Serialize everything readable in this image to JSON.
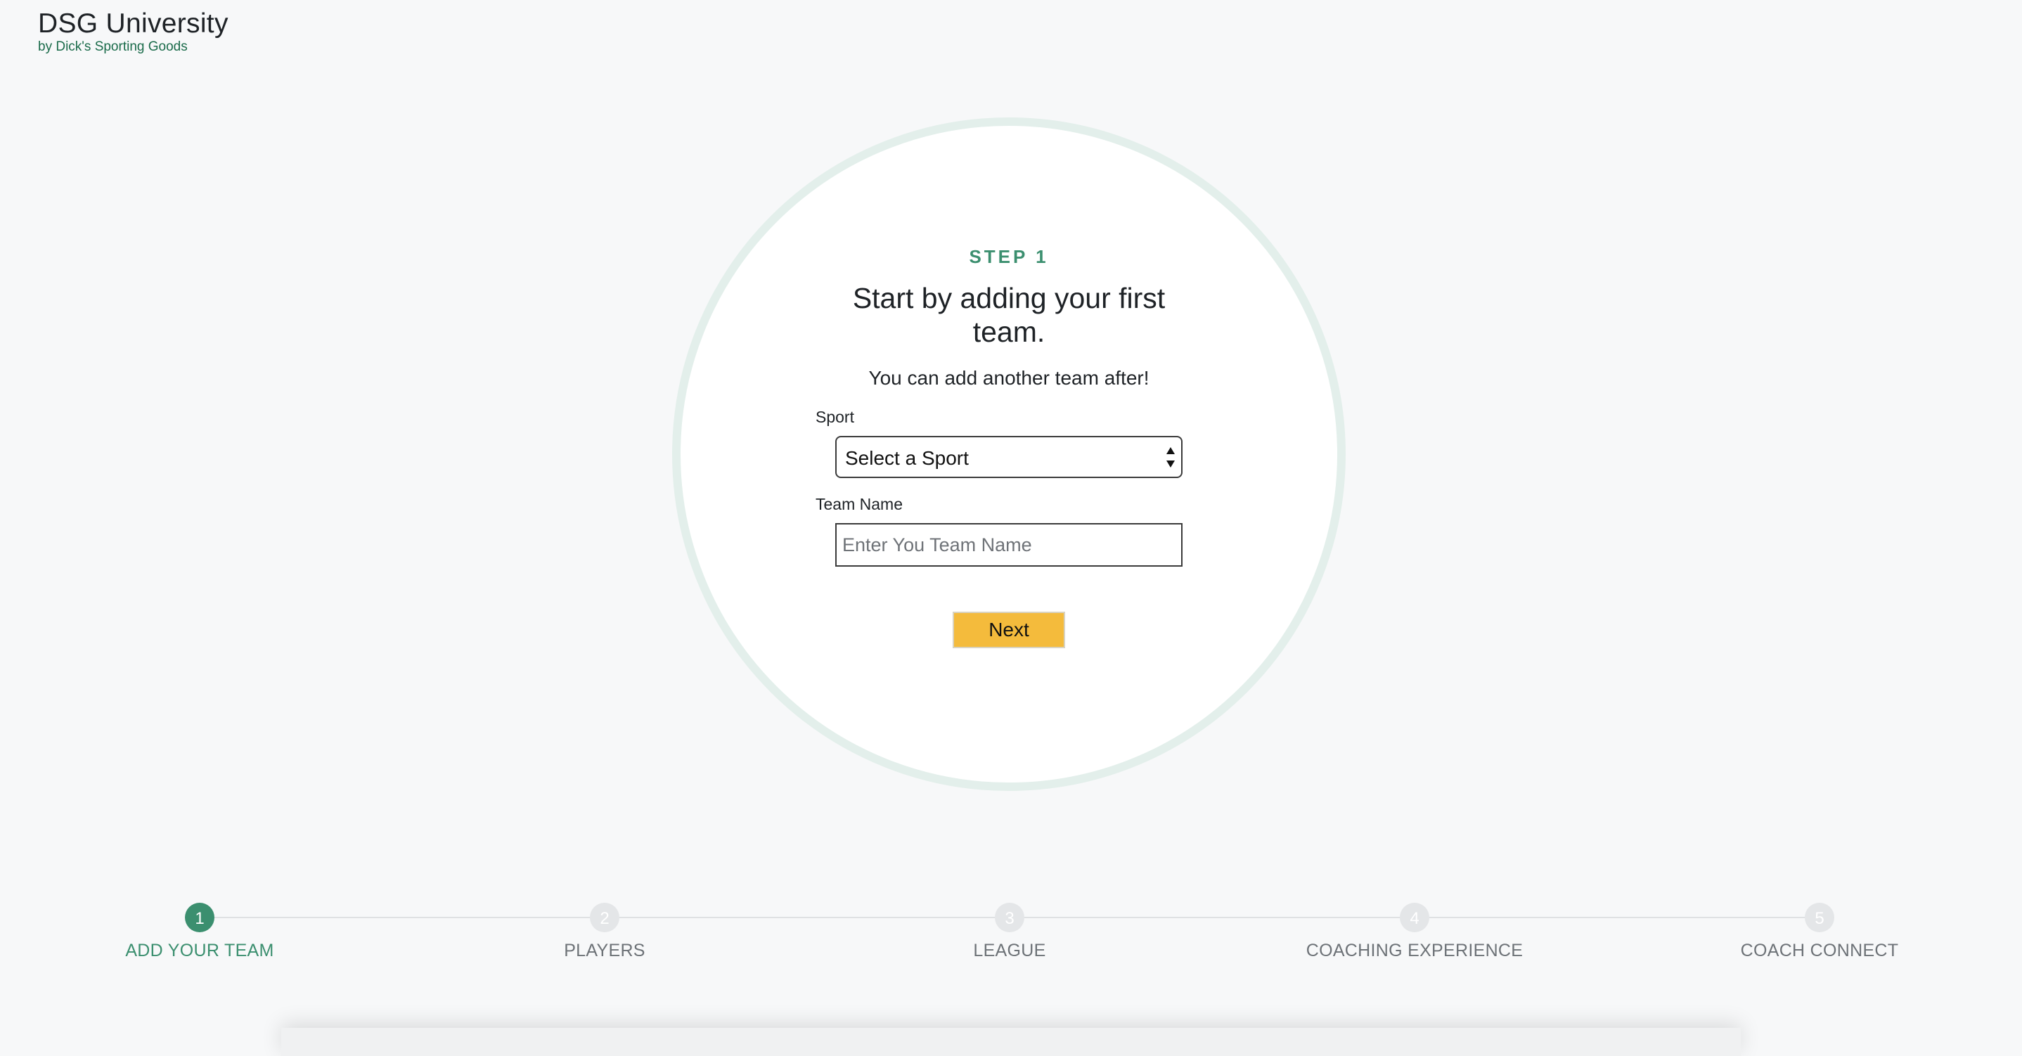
{
  "brand": {
    "title": "DSG University",
    "subtitle": "by Dick's Sporting Goods"
  },
  "form": {
    "step_label": "STEP 1",
    "headline": "Start by adding your first team.",
    "subline": "You can add another team after!",
    "sport_label": "Sport",
    "sport_select_value": "Select a Sport",
    "team_name_label": "Team Name",
    "team_name_placeholder": "Enter You Team Name",
    "team_name_value": "",
    "next_label": "Next"
  },
  "stepper": {
    "current_step": 1,
    "steps": [
      {
        "number": "1",
        "label": "ADD YOUR TEAM"
      },
      {
        "number": "2",
        "label": "PLAYERS"
      },
      {
        "number": "3",
        "label": "LEAGUE"
      },
      {
        "number": "4",
        "label": "COACHING EXPERIENCE"
      },
      {
        "number": "5",
        "label": "COACH CONNECT"
      }
    ]
  },
  "colors": {
    "accent_green": "#3b8f6f",
    "brand_green": "#1a6b4a",
    "button_yellow": "#f4bb3c",
    "circle_ring": "#e3efeb",
    "page_background": "#f7f8f9",
    "inactive_step": "#e4e6e8"
  },
  "icons": {
    "select_arrows": "select-arrows-icon"
  }
}
